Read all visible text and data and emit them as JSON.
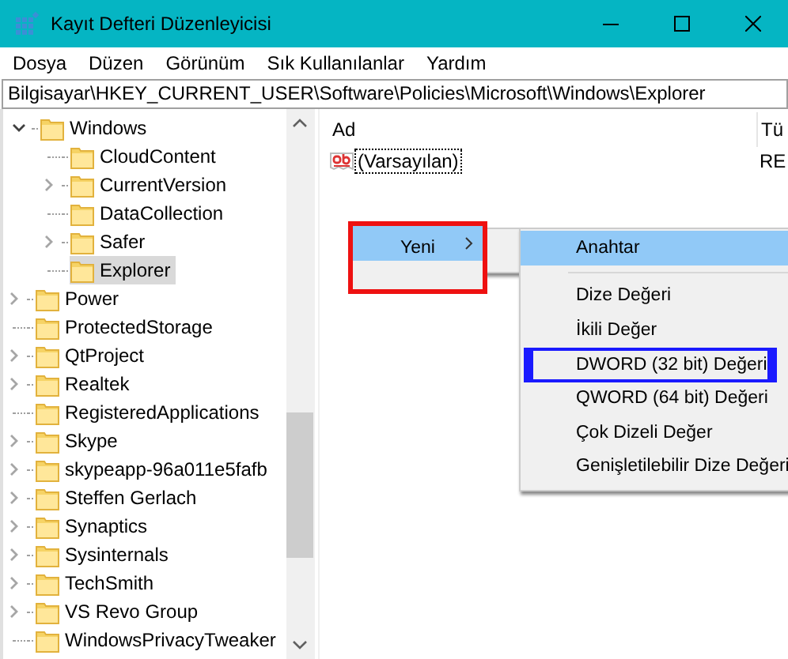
{
  "window": {
    "title": "Kayıt Defteri Düzenleyicisi"
  },
  "menu_bar": [
    "Dosya",
    "Düzen",
    "Görünüm",
    "Sık Kullanılanlar",
    "Yardım"
  ],
  "address_bar": {
    "value": "Bilgisayar\\HKEY_CURRENT_USER\\Software\\Policies\\Microsoft\\Windows\\Explorer"
  },
  "tree": {
    "items": [
      {
        "children": [
          {
            "children": [
              {
                "label": "Windows",
                "expandable": true,
                "expanded": true,
                "selected": false,
                "children": [
                  {
                    "label": "CloudContent",
                    "expandable": false,
                    "selected": false
                  },
                  {
                    "label": "CurrentVersion",
                    "expandable": true,
                    "expanded": false,
                    "selected": false
                  },
                  {
                    "label": "DataCollection",
                    "expandable": false,
                    "selected": false
                  },
                  {
                    "label": "Safer",
                    "expandable": true,
                    "expanded": false,
                    "selected": false
                  },
                  {
                    "label": "Explorer",
                    "expandable": false,
                    "selected": true
                  }
                ]
              }
            ]
          },
          {
            "label": "Power",
            "expandable": true,
            "expanded": false,
            "selected": false
          }
        ]
      },
      {
        "label": "ProtectedStorage",
        "expandable": false,
        "selected": false
      },
      {
        "label": "QtProject",
        "expandable": true,
        "expanded": false,
        "selected": false
      },
      {
        "label": "Realtek",
        "expandable": true,
        "expanded": false,
        "selected": false
      },
      {
        "label": "RegisteredApplications",
        "expandable": false,
        "selected": false
      },
      {
        "label": "Skype",
        "expandable": true,
        "expanded": false,
        "selected": false
      },
      {
        "label": "skypeapp-96a011e5fafb",
        "expandable": true,
        "expanded": false,
        "selected": false
      },
      {
        "label": "Steffen Gerlach",
        "expandable": true,
        "expanded": false,
        "selected": false
      },
      {
        "label": "Synaptics",
        "expandable": true,
        "expanded": false,
        "selected": false
      },
      {
        "label": "Sysinternals",
        "expandable": true,
        "expanded": false,
        "selected": false
      },
      {
        "label": "TechSmith",
        "expandable": true,
        "expanded": false,
        "selected": false
      },
      {
        "label": "VS Revo Group",
        "expandable": true,
        "expanded": false,
        "selected": false
      },
      {
        "label": "WindowsPrivacyTweaker",
        "expandable": false,
        "selected": false
      }
    ]
  },
  "values": {
    "columns": [
      "Ad",
      "Tü"
    ],
    "rows": [
      {
        "cells": [
          "(Varsayılan)",
          "RE"
        ],
        "focused": true
      }
    ]
  },
  "context_menu": {
    "items": [
      {
        "label": "Yeni",
        "has_submenu": true,
        "selected": true,
        "outlined": true
      }
    ]
  },
  "submenu": {
    "items": [
      {
        "kind": "item",
        "label": "Anahtar",
        "selected": true,
        "outlined": false
      },
      {
        "kind": "separator"
      },
      {
        "kind": "item",
        "label": "Dize Değeri",
        "selected": false,
        "outlined": false
      },
      {
        "kind": "item",
        "label": "İkili Değer",
        "selected": false,
        "outlined": false
      },
      {
        "kind": "item",
        "label": "DWORD (32 bit) Değeri",
        "selected": false,
        "outlined": true
      },
      {
        "kind": "item",
        "label": "QWORD (64 bit) Değeri",
        "selected": false,
        "outlined": false
      },
      {
        "kind": "item",
        "label": "Çok Dizeli Değer",
        "selected": false,
        "outlined": false
      },
      {
        "kind": "item",
        "label": "Genişletilebilir Dize Değeri",
        "selected": false,
        "outlined": false
      }
    ]
  }
}
